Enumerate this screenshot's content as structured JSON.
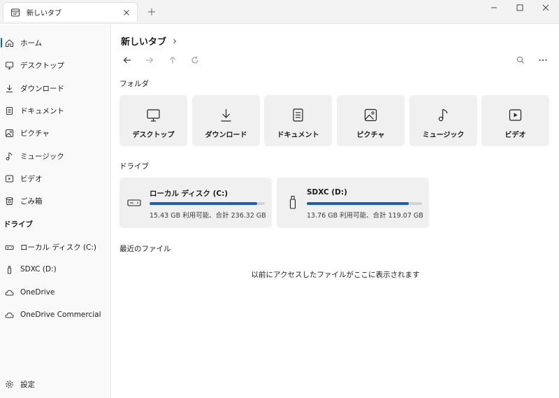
{
  "window": {
    "tab_title": "新しいタブ"
  },
  "sidebar": {
    "items": [
      {
        "label": "ホーム",
        "icon": "home-icon"
      },
      {
        "label": "デスクトップ",
        "icon": "desktop-icon"
      },
      {
        "label": "ダウンロード",
        "icon": "download-icon"
      },
      {
        "label": "ドキュメント",
        "icon": "document-icon"
      },
      {
        "label": "ピクチャ",
        "icon": "picture-icon"
      },
      {
        "label": "ミュージック",
        "icon": "music-icon"
      },
      {
        "label": "ビデオ",
        "icon": "video-icon"
      },
      {
        "label": "ごみ箱",
        "icon": "recycle-bin-icon"
      }
    ],
    "drives_heading": "ドライブ",
    "drives": [
      {
        "label": "ローカル ディスク (C:)",
        "icon": "hard-drive-icon"
      },
      {
        "label": "SDXC (D:)",
        "icon": "usb-drive-icon"
      },
      {
        "label": "OneDrive",
        "icon": "cloud-icon"
      },
      {
        "label": "OneDrive Commercial",
        "icon": "cloud-icon"
      }
    ],
    "settings_label": "設定"
  },
  "main": {
    "breadcrumb_title": "新しいタブ",
    "folders_heading": "フォルダ",
    "folders": [
      {
        "label": "デスクトップ",
        "icon": "desktop-icon"
      },
      {
        "label": "ダウンロード",
        "icon": "download-icon"
      },
      {
        "label": "ドキュメント",
        "icon": "document-icon"
      },
      {
        "label": "ピクチャ",
        "icon": "picture-icon"
      },
      {
        "label": "ミュージック",
        "icon": "music-icon"
      },
      {
        "label": "ビデオ",
        "icon": "video-icon"
      }
    ],
    "drives_heading": "ドライブ",
    "drives": [
      {
        "name": "ローカル ディスク (C:)",
        "info": "15.43 GB 利用可能、合計 236.32 GB",
        "used_fraction": 0.935,
        "icon": "hard-drive-icon"
      },
      {
        "name": "SDXC (D:)",
        "info": "13.76 GB 利用可能、合計 119.07 GB",
        "used_fraction": 0.884,
        "icon": "usb-drive-icon"
      }
    ],
    "recent_heading": "最近のファイル",
    "recent_empty": "以前にアクセスしたファイルがここに表示されます"
  },
  "colors": {
    "accent": "#0067c0",
    "progress_fill": "#1a5fb4",
    "progress_track": "#d3d3d3",
    "card_bg": "#f0f0f0",
    "sidebar_bg": "#f9f9f9"
  }
}
